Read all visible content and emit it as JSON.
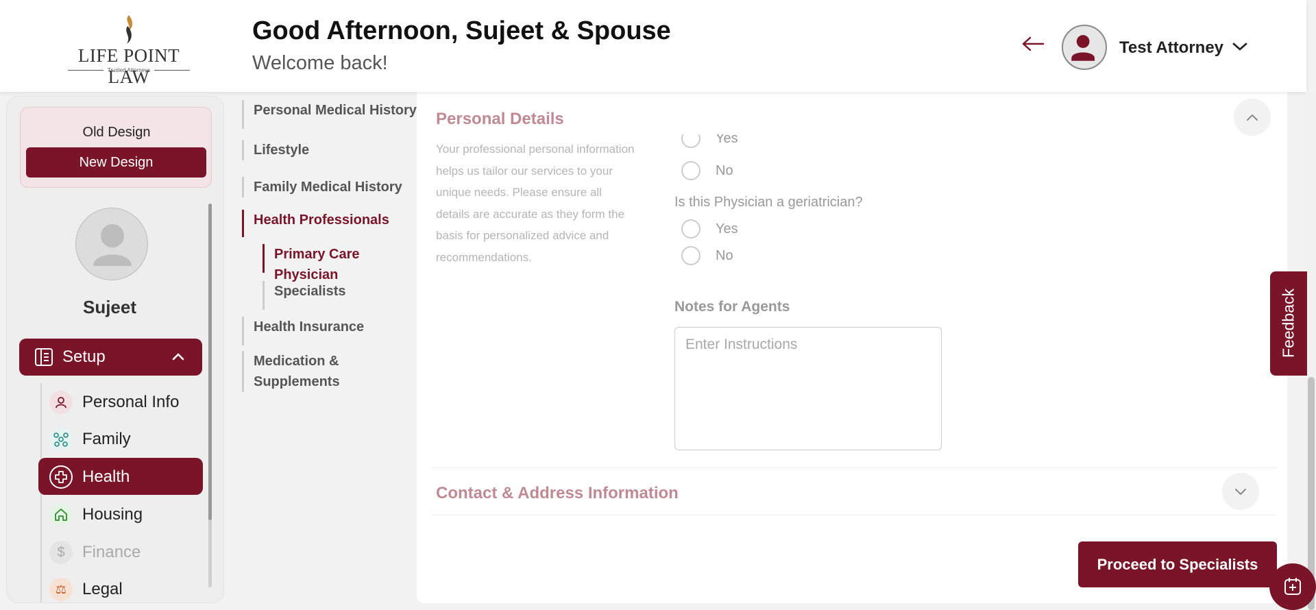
{
  "brand": {
    "name": "LIFE POINT LAW",
    "tagline": "Trusted Attorneys",
    "primary_color": "#7a1428"
  },
  "header": {
    "greeting": "Good Afternoon, Sujeet & Spouse",
    "welcome": "Welcome back!",
    "user_name": "Test Attorney",
    "back_icon": "arrow-left-icon",
    "menu_icon": "chevron-down-icon"
  },
  "sidebar": {
    "old_design": "Old Design",
    "new_design": "New Design",
    "profile_name": "Sujeet",
    "setup_label": "Setup",
    "items": [
      {
        "label": "Personal Info",
        "icon": "user-icon",
        "state": "normal"
      },
      {
        "label": "Family",
        "icon": "family-tree-icon",
        "state": "normal"
      },
      {
        "label": "Health",
        "icon": "health-cross-icon",
        "state": "active"
      },
      {
        "label": "Housing",
        "icon": "home-icon",
        "state": "normal"
      },
      {
        "label": "Finance",
        "icon": "dollar-icon",
        "state": "muted"
      },
      {
        "label": "Legal",
        "icon": "legal-icon",
        "state": "normal"
      }
    ]
  },
  "subnav": {
    "items": [
      {
        "label": "Personal Medical History"
      },
      {
        "label": "Lifestyle"
      },
      {
        "label": "Family Medical History"
      },
      {
        "label": "Health Professionals",
        "active": true
      },
      {
        "label": "Primary Care Physician",
        "active": true,
        "child": true
      },
      {
        "label": "Specialists",
        "child": true
      },
      {
        "label": "Health Insurance"
      },
      {
        "label": "Medication & Supplements"
      }
    ]
  },
  "main": {
    "personal_details_title": "Personal Details",
    "description": "Your professional personal information helps us tailor our services to your unique needs. Please ensure all details are accurate as they form the basis for personalized advice and recommendations.",
    "option_yes": "Yes",
    "option_no": "No",
    "geriatrician_question": "Is this Physician a geriatrician?",
    "notes_label": "Notes for Agents",
    "notes_placeholder": "Enter Instructions",
    "contact_title": "Contact & Address Information",
    "proceed_button": "Proceed to Specialists"
  },
  "feedback": {
    "label": "Feedback"
  }
}
